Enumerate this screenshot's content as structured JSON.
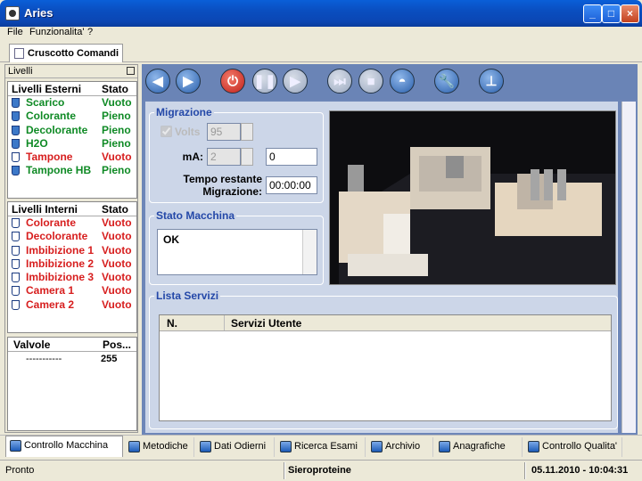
{
  "window": {
    "title": "Aries",
    "minimize": "_",
    "maximize": "□",
    "close": "×"
  },
  "menu": {
    "file": "File",
    "funzionalita": "Funzionalita'",
    "help": "?"
  },
  "top_tab": "Cruscotto Comandi",
  "left": {
    "header": "Livelli",
    "esterni": {
      "col1": "Livelli Esterni",
      "col2": "Stato",
      "rows": [
        {
          "name": "Scarico",
          "state": "Vuoto",
          "color": "g"
        },
        {
          "name": "Colorante",
          "state": "Pieno",
          "color": "g"
        },
        {
          "name": "Decolorante",
          "state": "Pieno",
          "color": "g"
        },
        {
          "name": "H2O",
          "state": "Pieno",
          "color": "g"
        },
        {
          "name": "Tampone",
          "state": "Vuoto",
          "color": "r"
        },
        {
          "name": "Tampone HB",
          "state": "Pieno",
          "color": "g"
        }
      ]
    },
    "interni": {
      "col1": "Livelli Interni",
      "col2": "Stato",
      "rows": [
        {
          "name": "Colorante",
          "state": "Vuoto"
        },
        {
          "name": "Decolorante",
          "state": "Vuoto"
        },
        {
          "name": "Imbibizione 1",
          "state": "Vuoto"
        },
        {
          "name": "Imbibizione 2",
          "state": "Vuoto"
        },
        {
          "name": "Imbibizione 3",
          "state": "Vuoto"
        },
        {
          "name": "Camera 1",
          "state": "Vuoto"
        },
        {
          "name": "Camera 2",
          "state": "Vuoto"
        }
      ]
    },
    "valvole": {
      "col1": "Valvole",
      "col2": "Pos...",
      "row_name": "-----------",
      "row_pos": "255"
    }
  },
  "toolbar": {
    "icons": [
      "back-icon",
      "forward-icon",
      "power-icon",
      "pause-icon",
      "play-icon",
      "skip-icon",
      "stop-icon",
      "dome-icon",
      "wrench-icon",
      "lamp-icon"
    ]
  },
  "migrazione": {
    "title": "Migrazione",
    "volts_label": "Volts",
    "volts_value": "95",
    "ma_label": "mA:",
    "ma_value": "2",
    "ma_actual": "0",
    "tempo_label1": "Tempo restante",
    "tempo_label2": "Migrazione:",
    "tempo_value": "00:00:00"
  },
  "stato": {
    "title": "Stato Macchina",
    "text": "OK"
  },
  "lista": {
    "title": "Lista Servizi",
    "col1": "N.",
    "col2": "Servizi Utente"
  },
  "bottom_tabs": [
    "Controllo Macchina",
    "Metodiche",
    "Dati Odierni",
    "Ricerca Esami",
    "Archivio",
    "Anagrafiche",
    "Controllo Qualita'"
  ],
  "status": {
    "left": "Pronto",
    "mid": "Sieroproteine",
    "right": "05.11.2010 - 10:04:31"
  }
}
